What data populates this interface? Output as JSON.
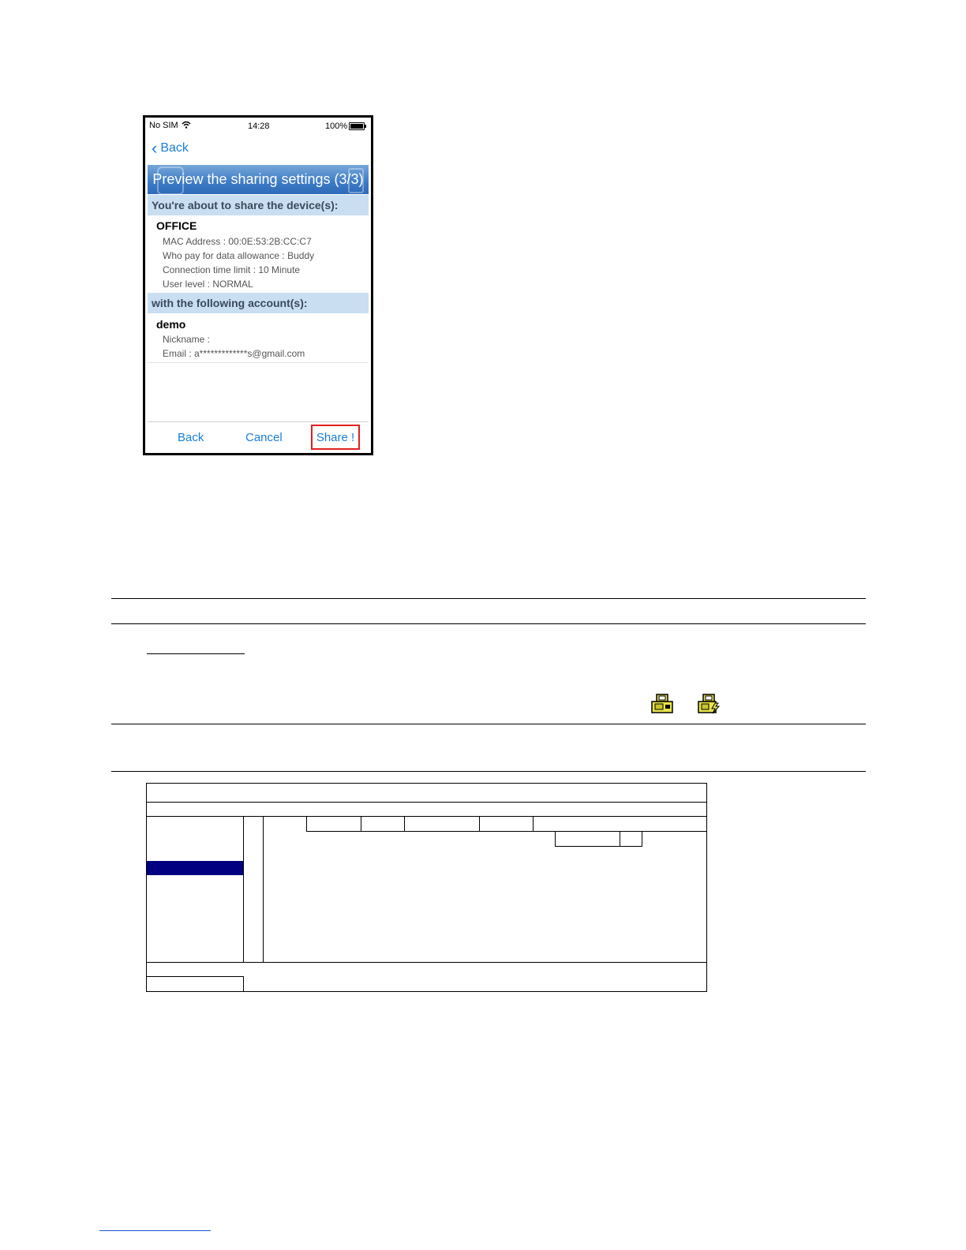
{
  "phone": {
    "status": {
      "carrier": "No SIM",
      "time": "14:28",
      "battery": "100%"
    },
    "nav_back_label": "Back",
    "title": "Preview the sharing settings (3/3)",
    "device_section_label": "You're about to share the device(s):",
    "device": {
      "name": "OFFICE",
      "mac": "MAC Address : 00:0E:53:2B:CC:C7",
      "payer": "Who pay for data allowance : Buddy",
      "time_limit": "Connection time limit : 10 Minute",
      "user_level": "User level : NORMAL"
    },
    "account_section_label": "with the following account(s):",
    "account": {
      "name": "demo",
      "nickname": "Nickname :",
      "email": "Email : a*************s@gmail.com"
    },
    "toolbar": {
      "back": "Back",
      "cancel": "Cancel",
      "share": "Share !"
    }
  },
  "colors": {
    "accent_blue": "#1a7ed6",
    "header_band": "#c9dff1",
    "share_highlight": "#e02020",
    "menu_selected": "#000080"
  },
  "icons": [
    "dvr-status-icon",
    "dvr-alert-icon"
  ]
}
